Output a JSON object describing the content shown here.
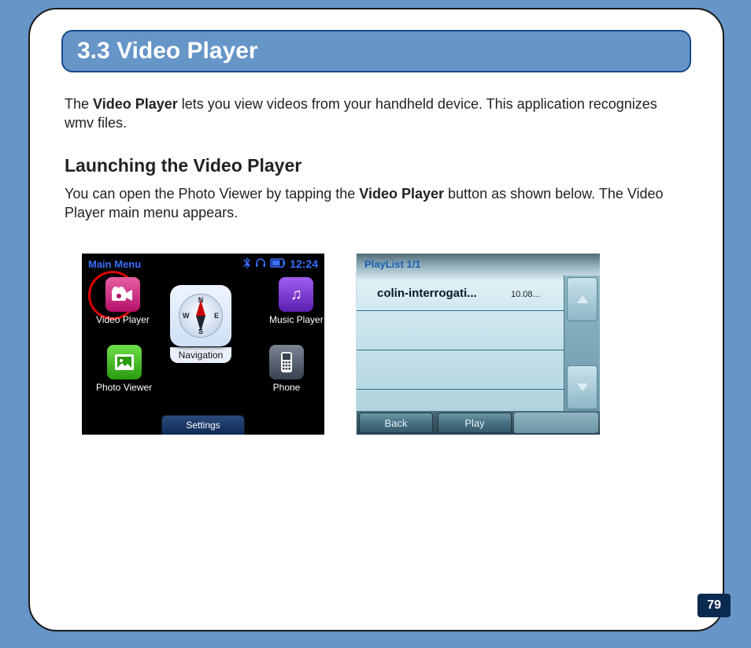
{
  "section": {
    "number": "3.3",
    "title": "Video Player"
  },
  "intro": {
    "pre": "The ",
    "bold1": "Video Player",
    "post": " lets you view videos from your handheld device. This application recognizes wmv files."
  },
  "subhead": "Launching the Video Player",
  "launch": {
    "pre": "You can open the Photo Viewer by tapping the ",
    "bold1": "Video Player",
    "post": " button as shown below. The Video Player main menu appears."
  },
  "mainmenu": {
    "title": "Main Menu",
    "clock": "12:24",
    "apps": {
      "video_player": "Video Player",
      "music_player": "Music Player",
      "photo_viewer": "Photo Viewer",
      "phone": "Phone",
      "navigation": "Navigation"
    },
    "compass": {
      "n": "N",
      "s": "S",
      "e": "E",
      "w": "W"
    },
    "settings": "Settings"
  },
  "playlist": {
    "header": "PlayList  1/1",
    "item_name": "colin-interrogati...",
    "item_time": "10.08...",
    "back": "Back",
    "play": "Play"
  },
  "page_number": "79"
}
